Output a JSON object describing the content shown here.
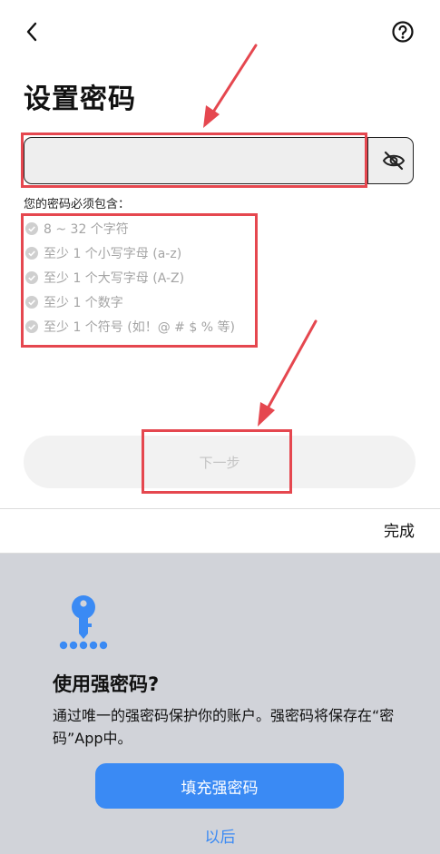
{
  "header": {
    "back_icon": "chevron-left-icon",
    "help_icon": "question-circle-icon"
  },
  "title": "设置密码",
  "password_field": {
    "value": "",
    "placeholder": "",
    "toggle_icon": "eye-slash-icon"
  },
  "requirements": {
    "title": "您的密码必须包含：",
    "items": [
      "8 ~ 32 个字符",
      "至少 1 个小写字母 (a-z)",
      "至少 1 个大写字母 (A-Z)",
      "至少 1 个数字",
      "至少 1 个符号 (如！@ # $ % 等)"
    ]
  },
  "next_button": "下一步",
  "keyboard_toolbar": {
    "done": "完成"
  },
  "strong_password_sheet": {
    "icon": "key-icon",
    "title": "使用强密码?",
    "description": "通过唯一的强密码保护你的账户。强密码将保存在“密码”App中。",
    "fill_button": "填充强密码",
    "later_link": "以后"
  },
  "colors": {
    "annotation": "#e5474f",
    "accent": "#3a8af4",
    "sheet_background": "#d1d3d9"
  }
}
